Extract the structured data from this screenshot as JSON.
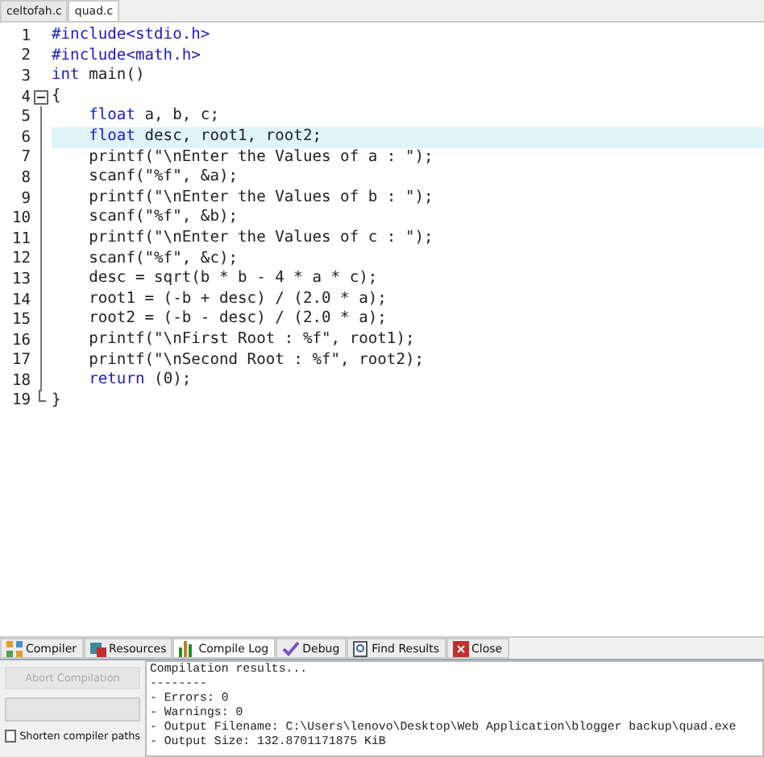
{
  "file_tabs": [
    {
      "label": "celtofah.c",
      "selected": false
    },
    {
      "label": "quad.c",
      "selected": true
    }
  ],
  "code_lines": [
    {
      "number": "1",
      "kind": "top",
      "segments": [
        {
          "kind": "directive",
          "text": "#include<stdio.h>"
        }
      ]
    },
    {
      "number": "2",
      "kind": "top",
      "segments": [
        {
          "kind": "directive",
          "text": "#include<math.h>"
        }
      ]
    },
    {
      "number": "3",
      "kind": "top",
      "segments": [
        {
          "kind": "keyword",
          "text": "int"
        },
        {
          "kind": "plain",
          "text": " main()"
        }
      ]
    },
    {
      "number": "4",
      "kind": "fold_start",
      "segments": [
        {
          "kind": "plain",
          "text": "{"
        }
      ]
    },
    {
      "number": "5",
      "kind": "body",
      "segments": [
        {
          "kind": "keyword",
          "text": "    float"
        },
        {
          "kind": "plain",
          "text": " a, b, c;"
        }
      ]
    },
    {
      "number": "6",
      "kind": "body",
      "selected": true,
      "segments": [
        {
          "kind": "keyword",
          "text": "    float"
        },
        {
          "kind": "plain",
          "text": " desc, root1, root2;"
        }
      ]
    },
    {
      "number": "7",
      "kind": "body",
      "segments": [
        {
          "kind": "plain",
          "text": "    printf(\"\\nEnter the Values of a : \");"
        }
      ]
    },
    {
      "number": "8",
      "kind": "body",
      "segments": [
        {
          "kind": "plain",
          "text": "    scanf(\"%f\", &a);"
        }
      ]
    },
    {
      "number": "9",
      "kind": "body",
      "segments": [
        {
          "kind": "plain",
          "text": "    printf(\"\\nEnter the Values of b : \");"
        }
      ]
    },
    {
      "number": "10",
      "kind": "body",
      "segments": [
        {
          "kind": "plain",
          "text": "    scanf(\"%f\", &b);"
        }
      ]
    },
    {
      "number": "11",
      "kind": "body",
      "segments": [
        {
          "kind": "plain",
          "text": "    printf(\"\\nEnter the Values of c : \");"
        }
      ]
    },
    {
      "number": "12",
      "kind": "body",
      "segments": [
        {
          "kind": "plain",
          "text": "    scanf(\"%f\", &c);"
        }
      ]
    },
    {
      "number": "13",
      "kind": "body",
      "segments": [
        {
          "kind": "plain",
          "text": "    desc = sqrt(b * b - 4 * a * c);"
        }
      ]
    },
    {
      "number": "14",
      "kind": "body",
      "segments": [
        {
          "kind": "plain",
          "text": "    root1 = (-b + desc) / (2.0 * a);"
        }
      ]
    },
    {
      "number": "15",
      "kind": "body",
      "segments": [
        {
          "kind": "plain",
          "text": "    root2 = (-b - desc) / (2.0 * a);"
        }
      ]
    },
    {
      "number": "16",
      "kind": "body",
      "segments": [
        {
          "kind": "plain",
          "text": "    printf(\"\\nFirst Root : %f\", root1);"
        }
      ]
    },
    {
      "number": "17",
      "kind": "body",
      "segments": [
        {
          "kind": "plain",
          "text": "    printf(\"\\nSecond Root : %f\", root2);"
        }
      ]
    },
    {
      "number": "18",
      "kind": "body",
      "segments": [
        {
          "kind": "keyword",
          "text": "    return"
        },
        {
          "kind": "plain",
          "text": " (0);"
        }
      ]
    },
    {
      "number": "19",
      "kind": "fold_end",
      "segments": [
        {
          "kind": "plain",
          "text": "}"
        }
      ]
    }
  ],
  "panel_tabs": [
    {
      "label": "Compiler",
      "selected": false
    },
    {
      "label": "Resources",
      "selected": false
    },
    {
      "label": "Compile Log",
      "selected": true
    },
    {
      "label": "Debug",
      "selected": false
    },
    {
      "label": "Find Results",
      "selected": false
    },
    {
      "label": "Close",
      "selected": false
    }
  ],
  "abort_button": {
    "label": "Abort Compilation",
    "disabled": true
  },
  "progress": {
    "level": 0
  },
  "shorten_paths": {
    "label": "Shorten compiler paths",
    "checked": false
  },
  "log_lines": [
    "Compilation results...",
    "--------",
    "- Errors: 0",
    "- Warnings: 0",
    "- Output Filename: C:\\Users\\lenovo\\Desktop\\Web Application\\blogger backup\\quad.exe",
    "- Output Size: 132.8701171875 KiB"
  ]
}
